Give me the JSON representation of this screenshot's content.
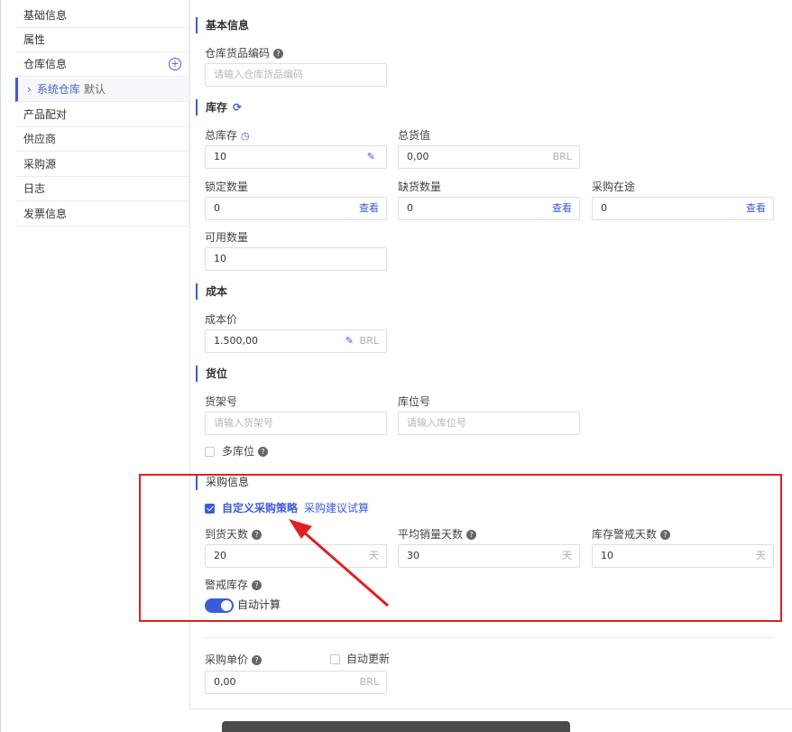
{
  "sidebar": {
    "items": [
      {
        "label": "基础信息"
      },
      {
        "label": "属性"
      },
      {
        "label": "仓库信息"
      },
      {
        "label": "系统仓库",
        "tag": "默认"
      },
      {
        "label": "产品配对"
      },
      {
        "label": "供应商"
      },
      {
        "label": "采购源"
      },
      {
        "label": "日志"
      },
      {
        "label": "发票信息"
      }
    ],
    "chevron": "›",
    "plus": "+"
  },
  "basic": {
    "title": "基本信息",
    "code_label": "仓库货品编码",
    "code_placeholder": "请输入仓库货品编码"
  },
  "stock": {
    "title": "库存",
    "refresh_icon": "⟳",
    "total_label": "总库存",
    "total_value": "10",
    "total_amount_label": "总货值",
    "total_amount_value": "0,00",
    "currency": "BRL",
    "locked_label": "锁定数量",
    "locked_value": "0",
    "short_label": "缺货数量",
    "short_value": "0",
    "transit_label": "采购在途",
    "transit_value": "0",
    "view_link": "查看",
    "available_label": "可用数量",
    "available_value": "10"
  },
  "cost": {
    "title": "成本",
    "price_label": "成本价",
    "price_value": "1.500,00",
    "currency": "BRL"
  },
  "location": {
    "title": "货位",
    "shelf_label": "货架号",
    "shelf_placeholder": "请输入货架号",
    "bin_label": "库位号",
    "bin_placeholder": "请输入库位号",
    "multi_label": "多库位"
  },
  "purchase": {
    "title": "采购信息",
    "custom_strategy": "自定义采购策略",
    "suggest_trial": "采购建议试算",
    "arrival_days_label": "到货天数",
    "arrival_days_value": "20",
    "avg_sales_label": "平均销量天数",
    "avg_sales_value": "30",
    "warn_days_label": "库存警戒天数",
    "warn_days_value": "10",
    "day_unit": "天",
    "warn_stock_label": "警戒库存",
    "auto_calc_label": "自动计算"
  },
  "unit_price": {
    "label": "采购单价",
    "auto_update_label": "自动更新",
    "value": "0,00",
    "currency": "BRL"
  },
  "colors": {
    "accent": "#3b5bdb",
    "highlight": "#e02020"
  }
}
